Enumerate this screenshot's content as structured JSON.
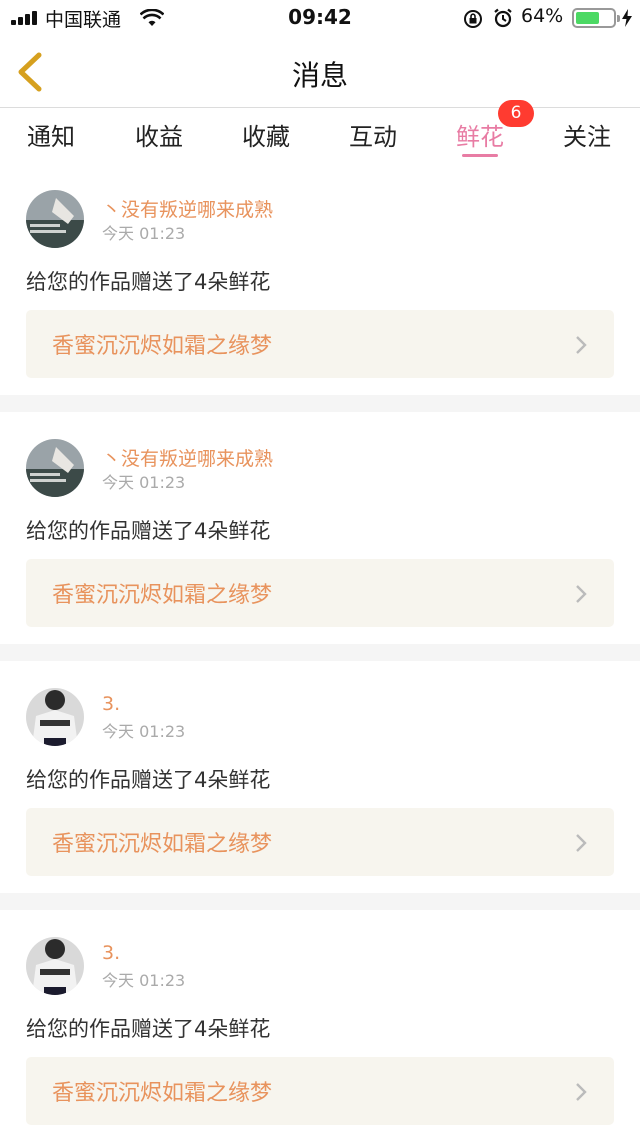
{
  "status_bar": {
    "carrier": "中国联通",
    "time": "09:42",
    "battery_percent": "64%",
    "battery_level": 0.64
  },
  "nav": {
    "title": "消息"
  },
  "tabs": [
    {
      "label": "通知"
    },
    {
      "label": "收益"
    },
    {
      "label": "收藏"
    },
    {
      "label": "互动"
    },
    {
      "label": "鲜花",
      "active": true,
      "badge": "6"
    },
    {
      "label": "关注"
    }
  ],
  "messages": [
    {
      "sender": "丶没有叛逆哪来成熟",
      "time": "今天 01:23",
      "text": "给您的作品赠送了4朵鲜花",
      "work_title": "香蜜沉沉烬如霜之缘梦",
      "avatar": "landscape-avatar"
    },
    {
      "sender": "丶没有叛逆哪来成熟",
      "time": "今天 01:23",
      "text": "给您的作品赠送了4朵鲜花",
      "work_title": "香蜜沉沉烬如霜之缘梦",
      "avatar": "landscape-avatar"
    },
    {
      "sender": "3.",
      "time": "今天 01:23",
      "text": "给您的作品赠送了4朵鲜花",
      "work_title": "香蜜沉沉烬如霜之缘梦",
      "avatar": "person-avatar"
    },
    {
      "sender": "3.",
      "time": "今天 01:23",
      "text": "给您的作品赠送了4朵鲜花",
      "work_title": "香蜜沉沉烬如霜之缘梦",
      "avatar": "person-avatar"
    }
  ],
  "colors": {
    "accent_pink": "#e87ca4",
    "accent_orange": "#e8935d",
    "badge_red": "#ff3b30",
    "card_bg": "#f7f5ee",
    "back_arrow": "#d6a01e"
  }
}
